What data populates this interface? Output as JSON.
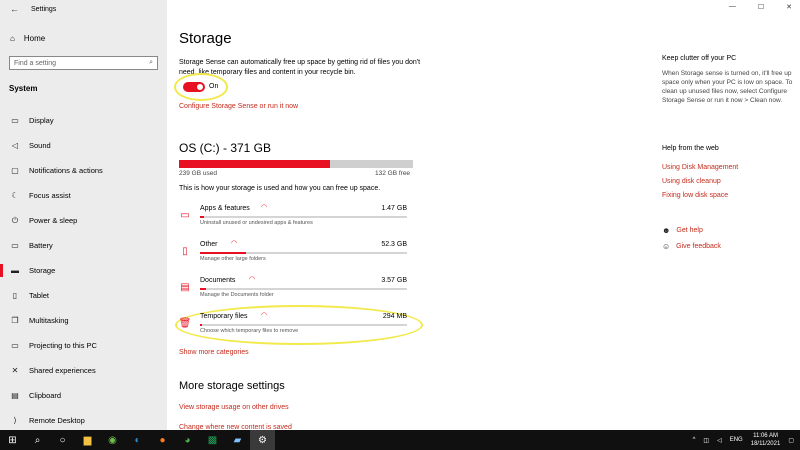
{
  "window": {
    "app_title": "Settings",
    "minimize": "—",
    "maximize": "☐",
    "close": "✕"
  },
  "sidebar": {
    "home": "Home",
    "search_placeholder": "Find a setting",
    "section": "System",
    "items": [
      {
        "label": "Display",
        "icon": "display-icon",
        "glyph": "▭"
      },
      {
        "label": "Sound",
        "icon": "sound-icon",
        "glyph": "◁"
      },
      {
        "label": "Notifications & actions",
        "icon": "notifications-icon",
        "glyph": "▢"
      },
      {
        "label": "Focus assist",
        "icon": "focus-assist-icon",
        "glyph": "☾"
      },
      {
        "label": "Power & sleep",
        "icon": "power-icon",
        "glyph": "⏻"
      },
      {
        "label": "Battery",
        "icon": "battery-icon",
        "glyph": "▭"
      },
      {
        "label": "Storage",
        "icon": "storage-icon",
        "glyph": "▬",
        "active": true
      },
      {
        "label": "Tablet",
        "icon": "tablet-icon",
        "glyph": "▯"
      },
      {
        "label": "Multitasking",
        "icon": "multitasking-icon",
        "glyph": "❐"
      },
      {
        "label": "Projecting to this PC",
        "icon": "projecting-icon",
        "glyph": "▭"
      },
      {
        "label": "Shared experiences",
        "icon": "shared-icon",
        "glyph": "✕"
      },
      {
        "label": "Clipboard",
        "icon": "clipboard-icon",
        "glyph": "▤"
      },
      {
        "label": "Remote Desktop",
        "icon": "remote-desktop-icon",
        "glyph": "⟩"
      }
    ]
  },
  "main": {
    "title": "Storage",
    "sense_desc": "Storage Sense can automatically free up space by getting rid of files you don't need, like temporary files and content in your recycle bin.",
    "toggle_label": "On",
    "toggle_on": true,
    "configure_link": "Configure Storage Sense or run it now",
    "drive_title": "OS (C:) - 371 GB",
    "used": "239 GB used",
    "free": "132 GB free",
    "used_fraction": 0.644,
    "usage_text": "This is how your storage is used and how you can free up space.",
    "categories": [
      {
        "name": "Apps & features",
        "size": "1.47 GB",
        "desc": "Uninstall unused or undesired apps & features",
        "fraction": 0.02
      },
      {
        "name": "Other",
        "size": "52.3 GB",
        "desc": "Manage other large folders",
        "fraction": 0.22
      },
      {
        "name": "Documents",
        "size": "3.57 GB",
        "desc": "Manage the Documents folder",
        "fraction": 0.03
      },
      {
        "name": "Temporary files",
        "size": "294 MB",
        "desc": "Choose which temporary files to remove",
        "fraction": 0.005
      }
    ],
    "show_more": "Show more categories",
    "more_title": "More storage settings",
    "view_usage": "View storage usage on other drives",
    "change_where": "Change where new content is saved"
  },
  "right": {
    "clutter_title": "Keep clutter off your PC",
    "clutter_desc": "When Storage sense is turned on, it'll free up space only when your PC is low on space. To clean up unused files now, select Configure Storage Sense or run it now > Clean now.",
    "help_title": "Help from the web",
    "links": [
      "Using Disk Management",
      "Using disk cleanup",
      "Fixing low disk space"
    ],
    "get_help": "Get help",
    "give_feedback": "Give feedback"
  },
  "taskbar": {
    "lang": "ENG",
    "time": "11:06 AM",
    "date": "18/11/2021"
  },
  "colors": {
    "accent": "#e81123",
    "link": "#c42b1c",
    "highlight": "#f2e94a"
  }
}
